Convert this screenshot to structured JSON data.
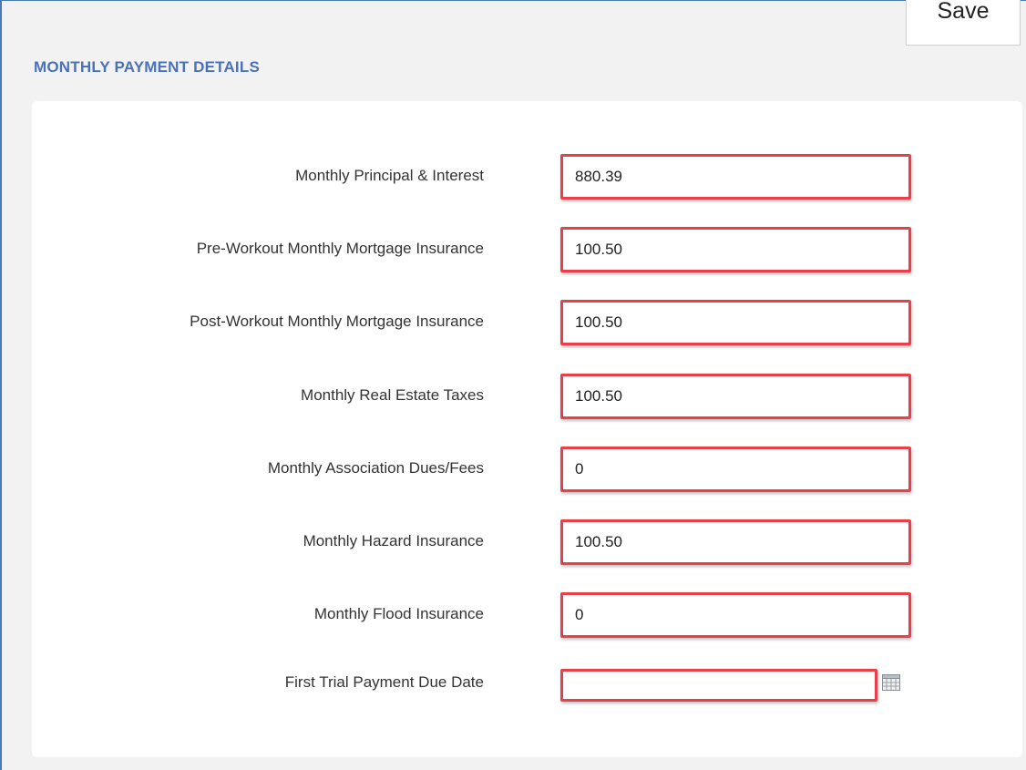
{
  "toolbar": {
    "save_label": "Save"
  },
  "section": {
    "title": "MONTHLY PAYMENT DETAILS"
  },
  "fields": [
    {
      "label": "Monthly Principal & Interest",
      "value": "880.39"
    },
    {
      "label": "Pre-Workout Monthly Mortgage Insurance",
      "value": "100.50"
    },
    {
      "label": "Post-Workout Monthly Mortgage Insurance",
      "value": "100.50"
    },
    {
      "label": "Monthly Real Estate Taxes",
      "value": "100.50"
    },
    {
      "label": "Monthly Association Dues/Fees",
      "value": "0"
    },
    {
      "label": "Monthly Hazard Insurance",
      "value": "100.50"
    },
    {
      "label": "Monthly Flood Insurance",
      "value": "0"
    },
    {
      "label": "First Trial Payment Due Date",
      "value": ""
    }
  ],
  "icons": {
    "date_picker": "calendar-icon"
  },
  "colors": {
    "title": "#4a72b8",
    "highlight": "#e8404a",
    "background": "#f2f2f2"
  }
}
